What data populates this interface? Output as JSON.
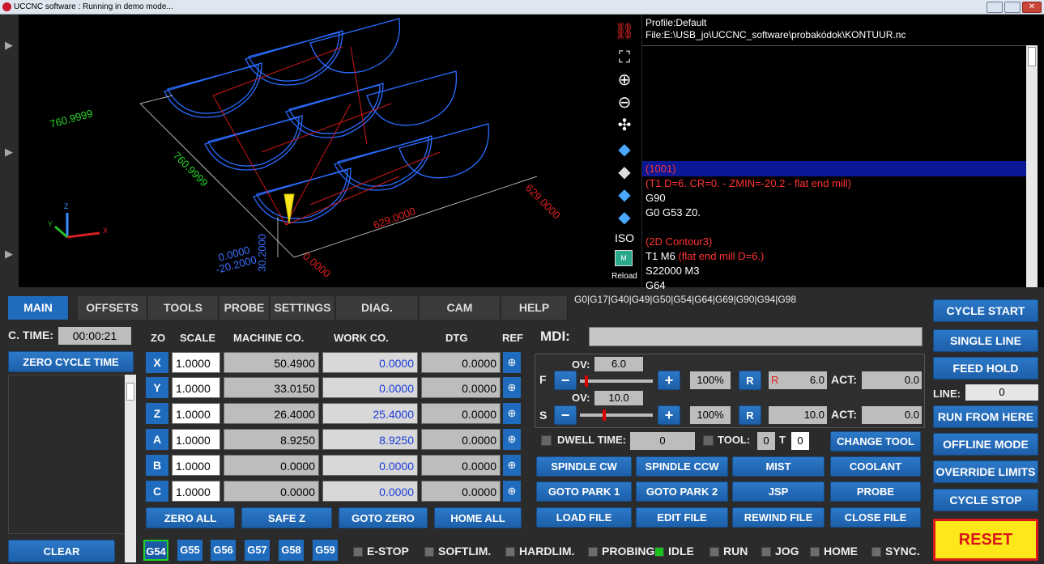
{
  "window": {
    "title": "UCCNC software : Running in demo mode..."
  },
  "view3d": {
    "dim_labels": [
      "760.9999",
      "760.9999",
      "629.0000",
      "629.0000",
      "30.2000",
      "-20.2000",
      "0.0000",
      "0.0000"
    ],
    "icons": [
      "uccnc-logo-icon",
      "fit-view-icon",
      "zoom-in-icon",
      "zoom-out-icon",
      "pan-icon",
      "view-cube-top-icon",
      "view-cube-front-icon",
      "view-cube-side-icon",
      "view-cube-right-icon"
    ],
    "iso_label": "ISO",
    "reload_label": "Reload",
    "reload_badge": "M"
  },
  "gcode": {
    "profile": "Profile:Default",
    "file": "File:E:\\USB_jo\\UCCNC_software\\probakódok\\KONTUUR.nc",
    "lines": [
      {
        "text": "(1001)",
        "color": "#ff2a2a",
        "highlight": true
      },
      {
        "text": "(T1  D=6. CR=0. - ZMIN=-20.2 - flat end mill)",
        "color": "#ff2a2a",
        "highlight": false
      },
      {
        "text": "G90",
        "color": "#ffffff",
        "highlight": false
      },
      {
        "text": "G0 G53 Z0.",
        "color": "#ffffff",
        "highlight": false
      },
      {
        "text": "",
        "color": "#ffffff",
        "highlight": false
      },
      {
        "text": "(2D Contour3)",
        "color": "#ff2a2a",
        "highlight": false
      },
      {
        "text": "T1 M6 ",
        "color": "#ffffff",
        "suffix": "(flat end mill D=6.)",
        "highlight": false
      },
      {
        "text": "S22000 M3",
        "color": "#ffffff",
        "highlight": false
      },
      {
        "text": "G64",
        "color": "#ffffff",
        "highlight": false
      }
    ]
  },
  "tabs": [
    "MAIN",
    "OFFSETS",
    "TOOLS",
    "PROBE",
    "SETTINGS",
    "DIAG.",
    "CAM",
    "HELP"
  ],
  "modal_codes": "G0|G17|G40|G49|G50|G54|G64|G69|G90|G94|G98",
  "cycle": {
    "label": "C. TIME:",
    "value": "00:00:21",
    "zero_btn": "ZERO CYCLE TIME",
    "clear_btn": "CLEAR"
  },
  "dro": {
    "headers": [
      "ZO",
      "SCALE",
      "MACHINE CO.",
      "WORK CO.",
      "DTG",
      "REF"
    ],
    "rows": [
      {
        "axis": "X",
        "scale": "1.0000",
        "machine": "50.4900",
        "work": "0.0000",
        "dtg": "0.0000"
      },
      {
        "axis": "Y",
        "scale": "1.0000",
        "machine": "33.0150",
        "work": "0.0000",
        "dtg": "0.0000"
      },
      {
        "axis": "Z",
        "scale": "1.0000",
        "machine": "26.4000",
        "work": "25.4000",
        "dtg": "0.0000"
      },
      {
        "axis": "A",
        "scale": "1.0000",
        "machine": "8.9250",
        "work": "8.9250",
        "dtg": "0.0000"
      },
      {
        "axis": "B",
        "scale": "1.0000",
        "machine": "0.0000",
        "work": "0.0000",
        "dtg": "0.0000"
      },
      {
        "axis": "C",
        "scale": "1.0000",
        "machine": "0.0000",
        "work": "0.0000",
        "dtg": "0.0000"
      }
    ],
    "buttons": [
      "ZERO ALL",
      "SAFE Z",
      "GOTO ZERO",
      "HOME ALL"
    ]
  },
  "mdi": {
    "label": "MDI:",
    "value": ""
  },
  "feed": {
    "label": "F",
    "ov_label": "OV:",
    "ov": "6.0",
    "percent": "100%",
    "r": "R",
    "r_small": "R",
    "value": "6.0",
    "act_label": "ACT:",
    "act": "0.0",
    "slider_level": 0.1
  },
  "spindle": {
    "label": "S",
    "ov_label": "OV:",
    "ov": "10.0",
    "percent": "100%",
    "r": "R",
    "value": "10.0",
    "act_label": "ACT:",
    "act": "0.0",
    "slider_level": 0.1
  },
  "dwell": {
    "label": "DWELL TIME:",
    "value": "0",
    "tool_label": "TOOL:",
    "tool_a": "0",
    "t_label": "T",
    "tool_b": "0",
    "change_tool": "CHANGE TOOL"
  },
  "action_buttons": [
    [
      "SPINDLE CW",
      "SPINDLE CCW",
      "MIST",
      "COOLANT"
    ],
    [
      "GOTO PARK 1",
      "GOTO PARK 2",
      "JSP",
      "PROBE"
    ],
    [
      "LOAD FILE",
      "EDIT FILE",
      "REWIND FILE",
      "CLOSE FILE"
    ]
  ],
  "right_buttons": {
    "cycle_start": "CYCLE START",
    "single_line": "SINGLE LINE",
    "feed_hold": "FEED HOLD",
    "line_label": "LINE:",
    "line_value": "0",
    "run_from_here": "RUN FROM HERE",
    "offline_mode": "OFFLINE MODE",
    "override_limits": "OVERRIDE LIMITS",
    "cycle_stop": "CYCLE STOP",
    "reset": "RESET"
  },
  "work_offsets": [
    "G54",
    "G55",
    "G56",
    "G57",
    "G58",
    "G59"
  ],
  "status": [
    {
      "label": "E-STOP",
      "on": false
    },
    {
      "label": "SOFTLIM.",
      "on": false
    },
    {
      "label": "HARDLIM.",
      "on": false
    },
    {
      "label": "PROBING",
      "on": false
    },
    {
      "label": "IDLE",
      "on": true
    },
    {
      "label": "RUN",
      "on": false
    },
    {
      "label": "JOG",
      "on": false
    },
    {
      "label": "HOME",
      "on": false
    },
    {
      "label": "SYNC.",
      "on": false
    }
  ]
}
